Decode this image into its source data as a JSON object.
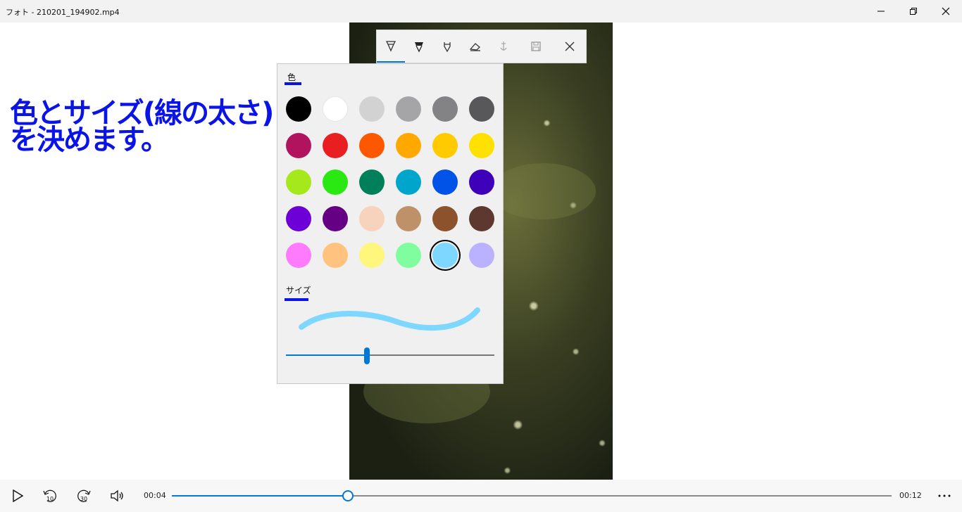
{
  "window": {
    "title": "フォト - 210201_194902.mp4"
  },
  "annotation": {
    "line1": "色とサイズ(線の太さ)",
    "line2": "を決めます。",
    "color": "#0a14e6"
  },
  "ink_toolbar": {
    "tools": [
      "ballpoint-pen-icon",
      "pencil-icon",
      "calligraphy-pen-icon",
      "eraser-icon",
      "touch-writing-icon",
      "save-icon",
      "close-icon"
    ],
    "selected_tool": "ballpoint-pen-icon"
  },
  "color_panel": {
    "color_label": "色",
    "size_label": "サイズ",
    "swatches": [
      "#000000",
      "#ffffff",
      "#d2d2d2",
      "#a5a5a8",
      "#838386",
      "#58585b",
      "#b2135f",
      "#e81e21",
      "#fd5800",
      "#ffa900",
      "#ffcb00",
      "#fee100",
      "#a5e81b",
      "#2ae812",
      "#00805a",
      "#00a5cc",
      "#0053e6",
      "#3f00b9",
      "#6d00d6",
      "#650084",
      "#f7d3be",
      "#be9168",
      "#8c522c",
      "#5d382e",
      "#ff7bfe",
      "#ffc27f",
      "#fff77b",
      "#80fd9f",
      "#7ed7fe",
      "#bbb2ff"
    ],
    "selected_swatch_index": 28,
    "size_value": 0.39,
    "accent_color": "#0078d7"
  },
  "player": {
    "current_time": "00:04",
    "total_time": "00:12",
    "progress": 0.245,
    "back_label": "10",
    "forward_label": "30"
  }
}
